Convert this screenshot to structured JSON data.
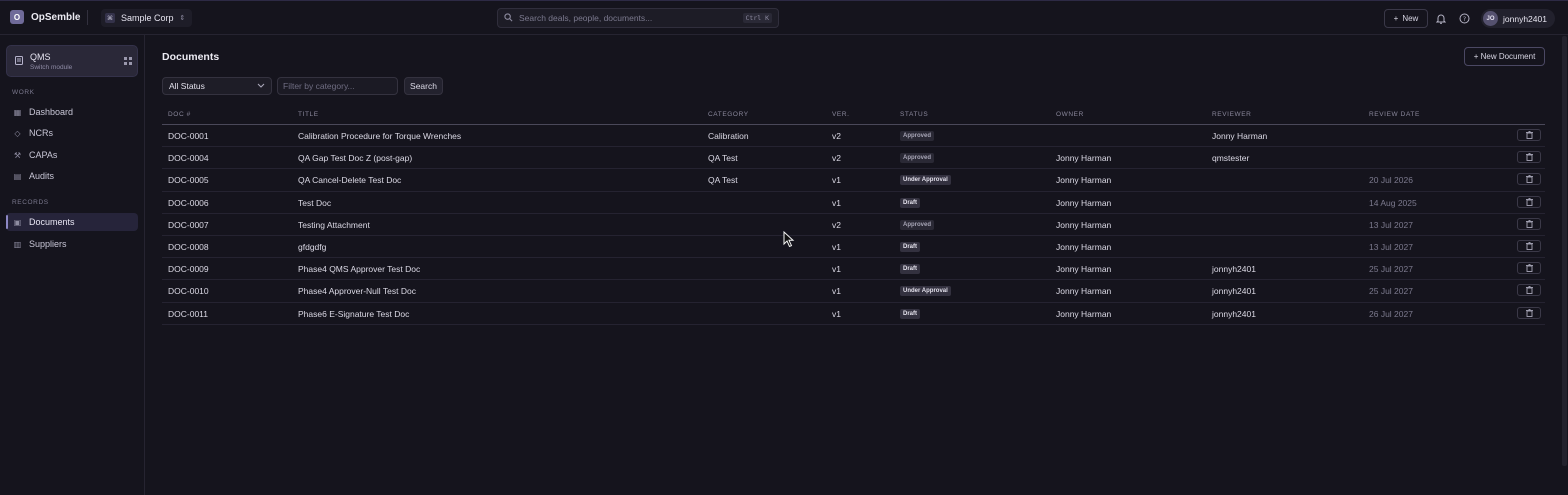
{
  "app": {
    "logo_letter": "O",
    "name": "OpSemble",
    "org": {
      "icon": "⌘",
      "name": "Sample Corp"
    }
  },
  "topbar": {
    "search_placeholder": "Search deals, people, documents...",
    "search_shortcut": "Ctrl K",
    "new_label": "New",
    "user": {
      "initials": "JO",
      "name": "jonnyh2401"
    }
  },
  "sidebar": {
    "module": {
      "title": "QMS",
      "subtitle": "Switch module"
    },
    "sections": [
      {
        "label": "WORK",
        "items": [
          {
            "label": "Dashboard",
            "icon": "grid-icon"
          },
          {
            "label": "NCRs",
            "icon": "diamond-icon"
          },
          {
            "label": "CAPAs",
            "icon": "wrench-icon"
          },
          {
            "label": "Audits",
            "icon": "clipboard-icon"
          }
        ]
      },
      {
        "label": "RECORDS",
        "items": [
          {
            "label": "Documents",
            "icon": "document-icon",
            "active": true
          },
          {
            "label": "Suppliers",
            "icon": "building-icon"
          }
        ]
      }
    ]
  },
  "main": {
    "title": "Documents",
    "new_document_label": "+ New Document",
    "filters": {
      "status_value": "All Status",
      "category_placeholder": "Filter by category...",
      "search_label": "Search"
    },
    "columns": [
      "DOC #",
      "TITLE",
      "CATEGORY",
      "VER.",
      "STATUS",
      "OWNER",
      "REVIEWER",
      "REVIEW DATE"
    ],
    "rows": [
      {
        "doc": "DOC-0001",
        "title": "Calibration Procedure for Torque Wrenches",
        "category": "Calibration",
        "ver": "v2",
        "status": "Approved",
        "owner": "",
        "reviewer": "Jonny Harman",
        "review_date": ""
      },
      {
        "doc": "DOC-0004",
        "title": "QA Gap Test Doc Z (post-gap)",
        "category": "QA Test",
        "ver": "v2",
        "status": "Approved",
        "owner": "Jonny Harman",
        "reviewer": "qmstester",
        "review_date": ""
      },
      {
        "doc": "DOC-0005",
        "title": "QA Cancel-Delete Test Doc",
        "category": "QA Test",
        "ver": "v1",
        "status": "Under Approval",
        "owner": "Jonny Harman",
        "reviewer": "",
        "review_date": "20 Jul 2026"
      },
      {
        "doc": "DOC-0006",
        "title": "Test Doc",
        "category": "",
        "ver": "v1",
        "status": "Draft",
        "owner": "Jonny Harman",
        "reviewer": "",
        "review_date": "14 Aug 2025"
      },
      {
        "doc": "DOC-0007",
        "title": "Testing Attachment",
        "category": "",
        "ver": "v2",
        "status": "Approved",
        "owner": "Jonny Harman",
        "reviewer": "",
        "review_date": "13 Jul 2027"
      },
      {
        "doc": "DOC-0008",
        "title": "gfdgdfg",
        "category": "",
        "ver": "v1",
        "status": "Draft",
        "owner": "Jonny Harman",
        "reviewer": "",
        "review_date": "13 Jul 2027"
      },
      {
        "doc": "DOC-0009",
        "title": "Phase4 QMS Approver Test Doc",
        "category": "",
        "ver": "v1",
        "status": "Draft",
        "owner": "Jonny Harman",
        "reviewer": "jonnyh2401",
        "review_date": "25 Jul 2027"
      },
      {
        "doc": "DOC-0010",
        "title": "Phase4 Approver-Null Test Doc",
        "category": "",
        "ver": "v1",
        "status": "Under Approval",
        "owner": "Jonny Harman",
        "reviewer": "jonnyh2401",
        "review_date": "25 Jul 2027"
      },
      {
        "doc": "DOC-0011",
        "title": "Phase6 E-Signature Test Doc",
        "category": "",
        "ver": "v1",
        "status": "Draft",
        "owner": "Jonny Harman",
        "reviewer": "jonnyh2401",
        "review_date": "26 Jul 2027"
      }
    ]
  },
  "colors": {
    "background": "#15141d",
    "active_nav": "#26243a",
    "accent": "#8c87c4"
  }
}
